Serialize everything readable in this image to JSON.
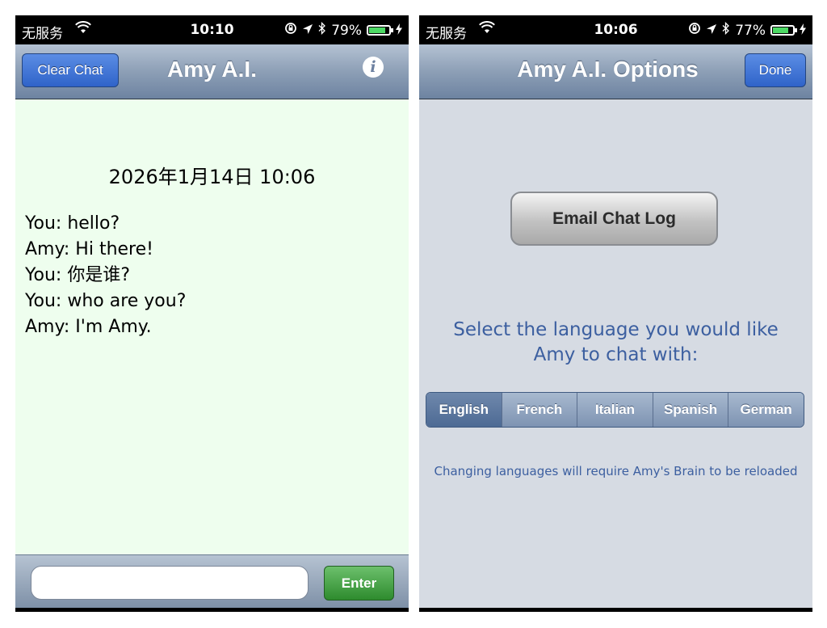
{
  "left_screen": {
    "status": {
      "carrier": "无服务",
      "time": "10:10",
      "battery": "79%"
    },
    "nav": {
      "title": "Amy A.I.",
      "clear_chat_label": "Clear Chat"
    },
    "chat": {
      "date": "2026年1月14日 10:06",
      "messages": [
        "You: hello?",
        "Amy: Hi there!",
        "You: 你是谁?",
        "You: who are you?",
        "Amy:  I'm Amy."
      ]
    },
    "input": {
      "value": "",
      "enter_label": "Enter"
    }
  },
  "right_screen": {
    "status": {
      "carrier": "无服务",
      "time": "10:06",
      "battery": "77%"
    },
    "nav": {
      "title": "Amy A.I. Options",
      "done_label": "Done"
    },
    "email_button_label": "Email Chat Log",
    "language_prompt": [
      "Select the language you would like",
      "Amy to chat with:"
    ],
    "languages": [
      "English",
      "French",
      "Italian",
      "Spanish",
      "German"
    ],
    "selected_language": "English",
    "language_note": "Changing languages will require Amy's Brain to be reloaded"
  },
  "icons": {
    "wifi": "wifi-icon",
    "lock_rotation": "rotation-lock-icon",
    "location": "location-arrow-icon",
    "bluetooth": "bluetooth-icon",
    "battery": "battery-icon",
    "charging": "charging-bolt-icon",
    "info": "info-icon"
  },
  "colors": {
    "chat_background": "#eefeee",
    "options_background": "#d6dbe3",
    "nav_button_blue": "#2f63c9",
    "enter_green": "#2e8b2e",
    "battery_green": "#4cd964"
  }
}
